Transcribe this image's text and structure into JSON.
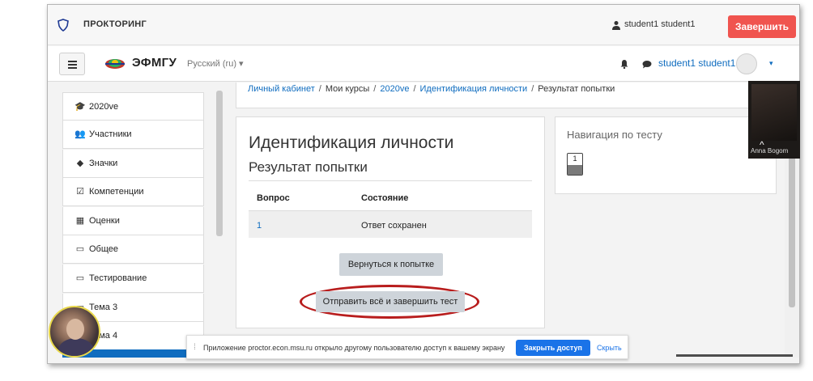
{
  "proctoring": {
    "title": "ПРОКТОРИНГ",
    "user": "student1 student1",
    "finish_button": "Завершить"
  },
  "navbar": {
    "site_name": "ЭФМГУ",
    "language": "Русский (ru) ▾",
    "user": "student1 student1",
    "caret": "▾"
  },
  "sidebar": {
    "items": [
      {
        "icon": "graduation-cap-icon",
        "glyph": "🎓",
        "label": "2020ve"
      },
      {
        "icon": "users-icon",
        "glyph": "👥",
        "label": "Участники"
      },
      {
        "icon": "shield-icon",
        "glyph": "◆",
        "label": "Значки"
      },
      {
        "icon": "checkbox-icon",
        "glyph": "☑",
        "label": "Компетенции"
      },
      {
        "icon": "table-icon",
        "glyph": "▦",
        "label": "Оценки"
      },
      {
        "icon": "folder-icon",
        "glyph": "▭",
        "label": "Общее"
      },
      {
        "icon": "folder-icon",
        "glyph": "▭",
        "label": "Тестирование"
      },
      {
        "icon": "folder-icon",
        "glyph": "▭",
        "label": "Тема 3"
      },
      {
        "icon": "folder-icon",
        "glyph": "▭",
        "label": "Тема 4"
      }
    ]
  },
  "breadcrumb": {
    "items": [
      "Личный кабинет",
      "Мои курсы",
      "2020ve",
      "Идентификация личности",
      "Результат попытки"
    ],
    "separator": "/"
  },
  "quiz": {
    "title": "Идентификация личности",
    "subtitle": "Результат попытки",
    "columns": [
      "Вопрос",
      "Состояние"
    ],
    "rows": [
      {
        "question": "1",
        "status": "Ответ сохранен"
      }
    ],
    "back_button": "Вернуться к попытке",
    "submit_button": "Отправить всё и завершить тест"
  },
  "quiz_navigation": {
    "title": "Навигация по тесту",
    "questions": [
      "1"
    ]
  },
  "video": {
    "caret": "^",
    "name": "Anna Bogom"
  },
  "share_bar": {
    "grip": "⁞",
    "text": "Приложение proctor.econ.msu.ru открыло другому пользователю доступ к вашему экрану",
    "stop_button": "Закрыть доступ",
    "hide_link": "Скрыть"
  },
  "colors": {
    "accent_red": "#f0544f",
    "link_blue": "#0f6cbf",
    "annotation_red": "#b81d1d",
    "share_blue": "#1a73e8"
  }
}
